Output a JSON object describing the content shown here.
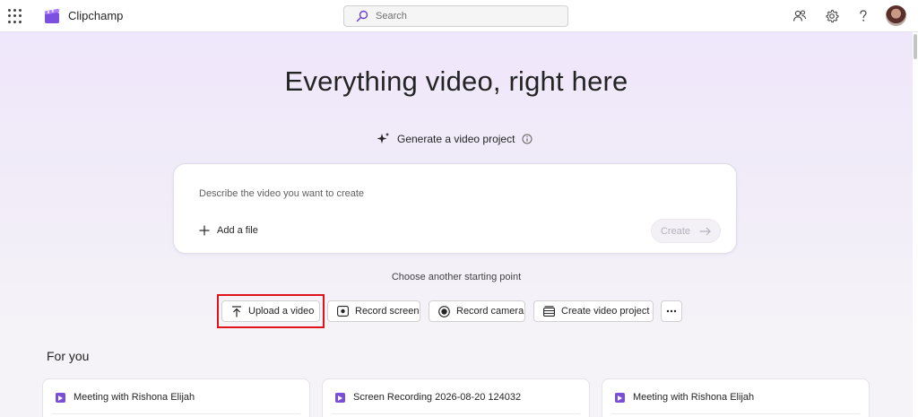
{
  "app": {
    "name": "Clipchamp",
    "search_placeholder": "Search",
    "icons": [
      "app-launcher-icon",
      "people-icon",
      "gear-icon",
      "help-icon",
      "avatar"
    ]
  },
  "hero": {
    "headline": "Everything video, right here",
    "generate_label": "Generate a video project",
    "prompt_placeholder": "Describe the video you want to create",
    "add_file_label": "Add a file",
    "create_label": "Create",
    "choose_label": "Choose another starting point"
  },
  "start_options": [
    {
      "label": "Upload a video",
      "icon": "upload-icon"
    },
    {
      "label": "Record screen",
      "icon": "record-screen-icon"
    },
    {
      "label": "Record camera",
      "icon": "record-camera-icon"
    },
    {
      "label": "Create video project",
      "icon": "video-project-icon"
    }
  ],
  "for_you": {
    "title": "For you",
    "cards": [
      {
        "title": "Meeting with Rishona Elijah"
      },
      {
        "title": "Screen Recording 2026-08-20 124032"
      },
      {
        "title": "Meeting with Rishona Elijah"
      }
    ]
  },
  "colors": {
    "accent": "#7a4fd6",
    "highlight": "#e0121b",
    "hero_top": "#efe7fb"
  }
}
